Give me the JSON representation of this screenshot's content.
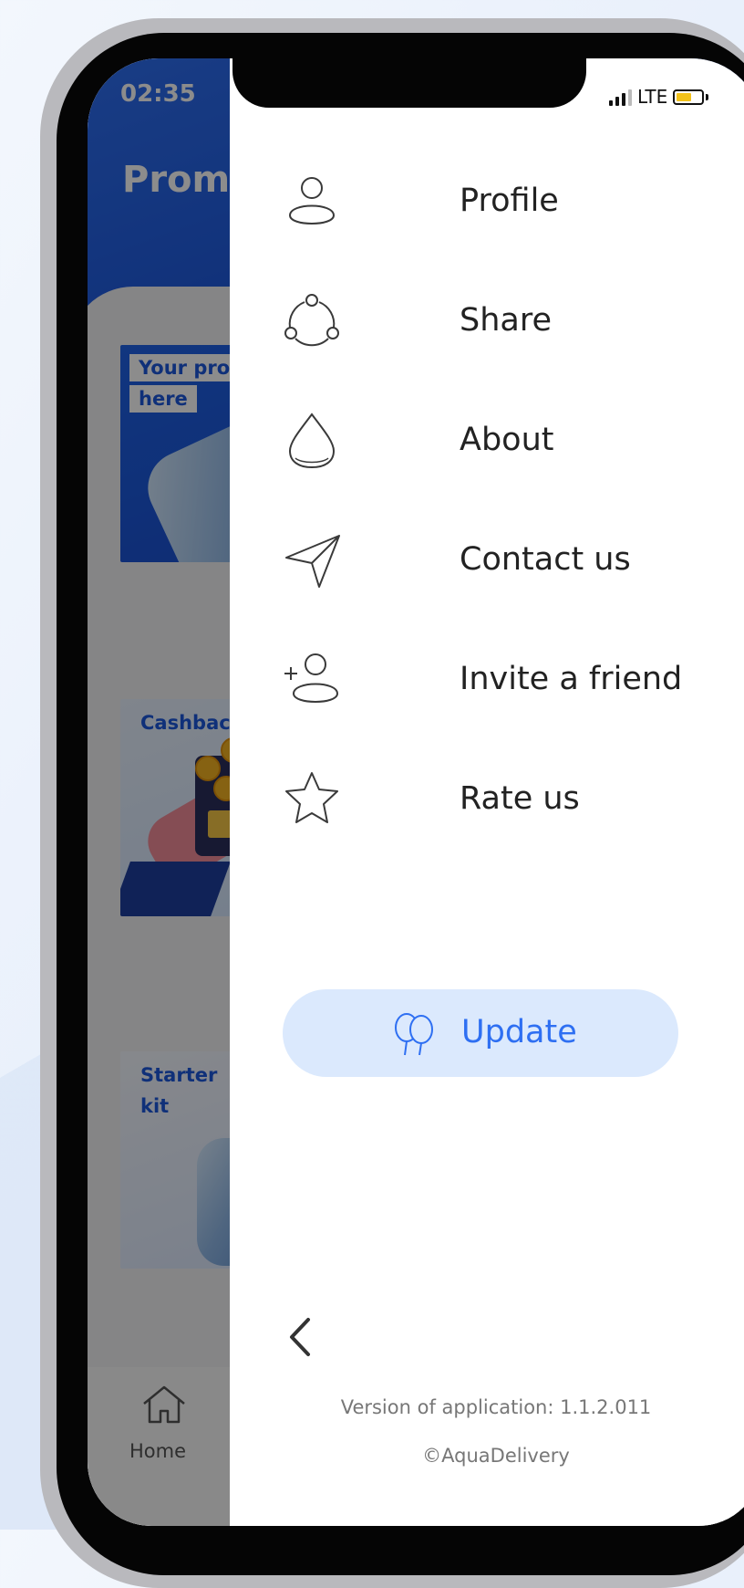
{
  "status_bar": {
    "time": "02:35",
    "network": "LTE"
  },
  "app": {
    "title": "Promotions",
    "cards": [
      {
        "label_line1": "Your promotion",
        "label_line2": "here"
      },
      {
        "label": "Cashback"
      },
      {
        "label_line1": "Starter",
        "label_line2": "kit"
      }
    ],
    "bottom_nav": {
      "home_label": "Home"
    }
  },
  "drawer": {
    "menu": [
      {
        "label": "Profile",
        "icon": "user-icon"
      },
      {
        "label": "Share",
        "icon": "share-icon"
      },
      {
        "label": "About",
        "icon": "drop-icon"
      },
      {
        "label": "Contact us",
        "icon": "send-icon"
      },
      {
        "label": "Invite a friend",
        "icon": "add-user-icon"
      },
      {
        "label": "Rate us",
        "icon": "star-icon"
      }
    ],
    "update_label": "Update",
    "update_icon": "balloons-icon",
    "back_icon": "chevron-left-icon",
    "version_text": "Version of application: 1.1.2.011",
    "copyright_text": "©AquaDelivery"
  },
  "colors": {
    "primary": "#2E6FF2",
    "update_button_bg": "#DBE9FD",
    "drawer_bg": "#FFFFFF",
    "icon_stroke": "#3A3A3A"
  }
}
